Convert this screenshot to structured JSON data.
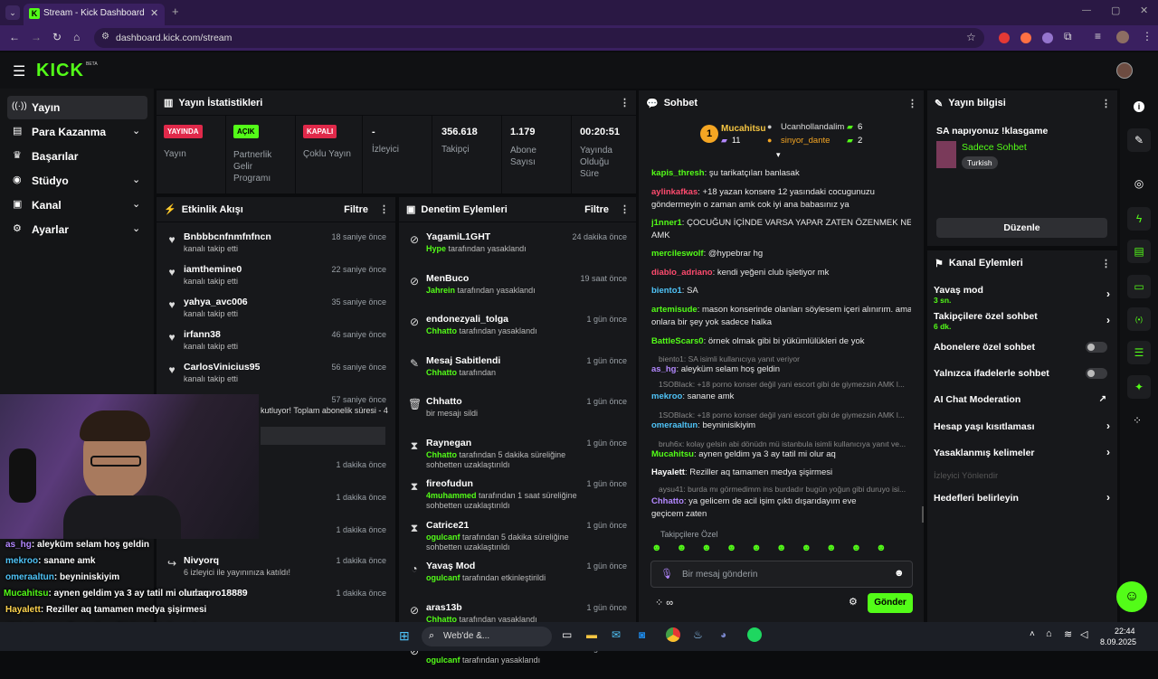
{
  "browser": {
    "tab_title": "Stream - Kick Dashboard",
    "url": "dashboard.kick.com/stream"
  },
  "kick": {
    "logo": "KICK",
    "beta": "BETA"
  },
  "sidebar": {
    "items": [
      {
        "label": "Yayın",
        "icon": "broadcast-icon"
      },
      {
        "label": "Para Kazanma",
        "icon": "money-icon"
      },
      {
        "label": "Başarılar",
        "icon": "trophy-icon"
      },
      {
        "label": "Stüdyo",
        "icon": "studio-icon"
      },
      {
        "label": "Kanal",
        "icon": "channel-icon"
      },
      {
        "label": "Ayarlar",
        "icon": "settings-icon"
      }
    ]
  },
  "stats": {
    "title": "Yayın İstatistikleri",
    "cells": [
      {
        "badge": "YAYINDA",
        "label": "Yayın"
      },
      {
        "badge": "AÇIK",
        "label": "Partnerlik Gelir Programı"
      },
      {
        "badge": "KAPALI",
        "label": "Çoklu Yayın"
      },
      {
        "value": "-",
        "label": "İzleyici"
      },
      {
        "value": "356.618",
        "label": "Takipçi"
      },
      {
        "value": "1.179",
        "label": "Abone Sayısı"
      },
      {
        "value": "00:20:51",
        "label": "Yayında Olduğu Süre"
      }
    ]
  },
  "activity": {
    "title": "Etkinlik Akışı",
    "filter": "Filtre",
    "rows": [
      {
        "name": "Bnbbbcnfnmfnfncn",
        "desc": "kanalı takip etti",
        "time": "18 saniye önce"
      },
      {
        "name": "iamthemine0",
        "desc": "kanalı takip etti",
        "time": "22 saniye önce"
      },
      {
        "name": "yahya_avc006",
        "desc": "kanalı takip etti",
        "time": "35 saniye önce"
      },
      {
        "name": "irfann38",
        "desc": "kanalı takip etti",
        "time": "46 saniye önce"
      },
      {
        "name": "CarlosVinicius95",
        "desc": "kanalı takip etti",
        "time": "56 saniye önce"
      },
      {
        "name": "",
        "desc": "kutluyor! Toplam abonelik süresi - 4",
        "time": "57 saniye önce"
      },
      {
        "name": "",
        "desc": "",
        "time": "1 dakika önce"
      },
      {
        "name": "",
        "desc": "",
        "time": "1 dakika önce"
      },
      {
        "name": "",
        "desc": "",
        "time": "1 dakika önce"
      },
      {
        "name": "Nivyorq",
        "desc": "6 izleyici ile yayınınıza katıldı!",
        "time": "1 dakika önce"
      },
      {
        "name": "babapro18889",
        "desc": "",
        "time": "1 dakika önce"
      }
    ]
  },
  "moderation": {
    "title": "Denetim Eylemleri",
    "filter": "Filtre",
    "rows": [
      {
        "name": "YagamiL1GHT",
        "by": "Hype",
        "desc": "tarafından yasaklandı",
        "time": "24 dakika önce",
        "icon": "ban-icon"
      },
      {
        "name": "MenBuco",
        "by": "Jahrein",
        "desc": "tarafından yasaklandı",
        "time": "19 saat önce",
        "icon": "ban-icon"
      },
      {
        "name": "endonezyali_tolga",
        "by": "Chhatto",
        "desc": "tarafından yasaklandı",
        "time": "1 gün önce",
        "icon": "ban-icon"
      },
      {
        "name": "Mesaj Sabitlendi",
        "by": "Chhatto",
        "desc": "tarafından",
        "time": "1 gün önce",
        "icon": "pin-icon"
      },
      {
        "name": "Chhatto",
        "by": "",
        "desc": "bir mesajı sildi",
        "time": "1 gün önce",
        "icon": "trash-icon"
      },
      {
        "name": "Raynegan",
        "by": "Chhatto",
        "desc": "tarafından 5 dakika süreliğine sohbetten uzaklaştırıldı",
        "time": "1 gün önce",
        "icon": "hourglass-icon"
      },
      {
        "name": "fireofudun",
        "by": "4muhammed",
        "desc": "tarafından 1 saat süreliğine sohbetten uzaklaştırıldı",
        "time": "1 gün önce",
        "icon": "hourglass-icon"
      },
      {
        "name": "Catrice21",
        "by": "ogulcanf",
        "desc": "tarafından 5 dakika süreliğine sohbetten uzaklaştırıldı",
        "time": "1 gün önce",
        "icon": "hourglass-icon"
      },
      {
        "name": "Yavaş Mod",
        "by": "ogulcanf",
        "desc": "tarafından etkinleştirildi",
        "time": "1 gün önce",
        "icon": "slow-icon"
      },
      {
        "name": "aras13b",
        "by": "Chhatto",
        "desc": "tarafından yasaklandı",
        "time": "1 gün önce",
        "icon": "ban-icon"
      },
      {
        "name": "aras13b",
        "by": "ogulcanf",
        "desc": "tarafından yasaklandı",
        "time": "1 gün önce",
        "icon": "ban-icon"
      }
    ]
  },
  "chat": {
    "title": "Sohbet",
    "top": {
      "rank": "1",
      "user": "Mucahitsu",
      "count": "11",
      "u2": "Ucanhollandalim",
      "c2": "6",
      "u3": "sinyor_dante",
      "c3": "2"
    },
    "messages": [
      {
        "user": "kapis_thresh",
        "color": "#53fc18",
        "text": "şu tarikatçıları banlasak"
      },
      {
        "user": "aylinkafkas",
        "color": "#ff4b6e",
        "text": "+18 yazan konsere 12 yasındaki cocugunuzu"
      },
      {
        "user": "",
        "color": "#fff",
        "text": "göndermeyin o zaman amk cok iyi ana babasınız ya"
      },
      {
        "user": "j1nner1",
        "color": "#53fc18",
        "text": "ÇOCUĞUN İÇİNDE VARSA YAPAR ZATEN ÖZENMEK NE"
      },
      {
        "user": "",
        "color": "#fff",
        "text": "AMK"
      },
      {
        "user": "mercileswolf",
        "color": "#53fc18",
        "text": "@hypebrar hg"
      },
      {
        "user": "diablo_adriano",
        "color": "#ff4b6e",
        "text": "kendi yeğeni club işletiyor mk"
      },
      {
        "user": "biento1",
        "color": "#4fc3f7",
        "text": "SA"
      },
      {
        "user": "artemisude",
        "color": "#53fc18",
        "text": "mason konserinde olanları söylesem içeri alınırım. ama"
      },
      {
        "user": "",
        "color": "#fff",
        "text": "onlara bir şey yok sadece halka"
      },
      {
        "user": "BattleScars0",
        "color": "#53fc18",
        "text": "örnek olmak gibi bi yükümlülükleri de yok"
      },
      {
        "user": "",
        "color": "#888",
        "text": "biento1: SA isimli kullanıcıya yanıt veriyor"
      },
      {
        "user": "as_hg",
        "color": "#b388ff",
        "text": "aleyküm selam hoş geldin"
      },
      {
        "user": "",
        "color": "#888",
        "text": "1SOBlack: +18 porno konser değil yani escort gibi de giymezsin AMK l..."
      },
      {
        "user": "mekroo",
        "color": "#4fc3f7",
        "text": "sanane amk"
      },
      {
        "user": "",
        "color": "#888",
        "text": "1SOBlack: +18 porno konser değil yani escort gibi de giymezsin AMK l..."
      },
      {
        "user": "omeraaltun",
        "color": "#4fc3f7",
        "text": "beyninisikiyim"
      },
      {
        "user": "",
        "color": "#888",
        "text": "bruh6x: kolay gelsin abi dönüdn mü istanbula isimli kullanıcıya yanıt ve..."
      },
      {
        "user": "Mucahitsu",
        "color": "#53fc18",
        "text": "aynen geldim ya 3 ay tatil mi olur aq"
      },
      {
        "user": "Hayalett",
        "color": "#fff",
        "text": "Reziller aq tamamen medya şişirmesi"
      },
      {
        "user": "",
        "color": "#888",
        "text": "aysu41: burda mı görmedimm ins burdadır bugün yoğun gibi duruyo isi..."
      },
      {
        "user": "Chhatto",
        "color": "#b388ff",
        "text": "ya gelicem de acil işim çıktı dışarıdayım eve"
      },
      {
        "user": "",
        "color": "#fff",
        "text": "geçicem zaten"
      }
    ],
    "follower_only": "Takipçilere Özel",
    "placeholder": "Bir mesaj gönderin",
    "send": "Gönder"
  },
  "info": {
    "title": "Yayın bilgisi",
    "stream_title": "SA napıyonuz !klasgame",
    "category": "Sadece Sohbet",
    "tag": "Turkish",
    "edit": "Düzenle"
  },
  "actions": {
    "title": "Kanal Eylemleri",
    "items": [
      {
        "label": "Yavaş mod",
        "sub": "3 sn."
      },
      {
        "label": "Takipçilere özel sohbet",
        "sub": "6 dk."
      },
      {
        "label": "Abonelere özel sohbet"
      },
      {
        "label": "Yalnızca ifadelerle sohbet"
      },
      {
        "label": "AI Chat Moderation"
      },
      {
        "label": "Hesap yaşı kısıtlaması"
      },
      {
        "label": "Yasaklanmış kelimeler"
      },
      {
        "label": "İzleyici Yönlendir"
      },
      {
        "label": "Hedefleri belirleyin"
      }
    ]
  },
  "overlay": {
    "lines": [
      {
        "user": "as_hg",
        "color": "#b388ff",
        "text": ": aleyküm selam hoş geldin"
      },
      {
        "user": "mekroo",
        "color": "#4fc3f7",
        "text": ": sanane amk"
      },
      {
        "user": "omeraaltun",
        "color": "#4fc3f7",
        "text": ": beyniniskiyim"
      },
      {
        "user": "Mucahitsu",
        "color": "#53fc18",
        "text": ": aynen geldim ya 3 ay tatil mi olur aq"
      },
      {
        "user": "Hayalett",
        "color": "#ffd54f",
        "text": ": Reziller aq tamamen medya şişirmesi"
      },
      {
        "user": "Chhatto",
        "color": "#b388ff",
        "text": ": ya gelicem de acil işim çıktı dışarıdayım"
      },
      {
        "user": "",
        "color": "#fff",
        "text": "geçicem zaten"
      }
    ]
  },
  "taskbar": {
    "search": "Web'de &...",
    "time": "22:44",
    "date": "8.09.2025"
  }
}
